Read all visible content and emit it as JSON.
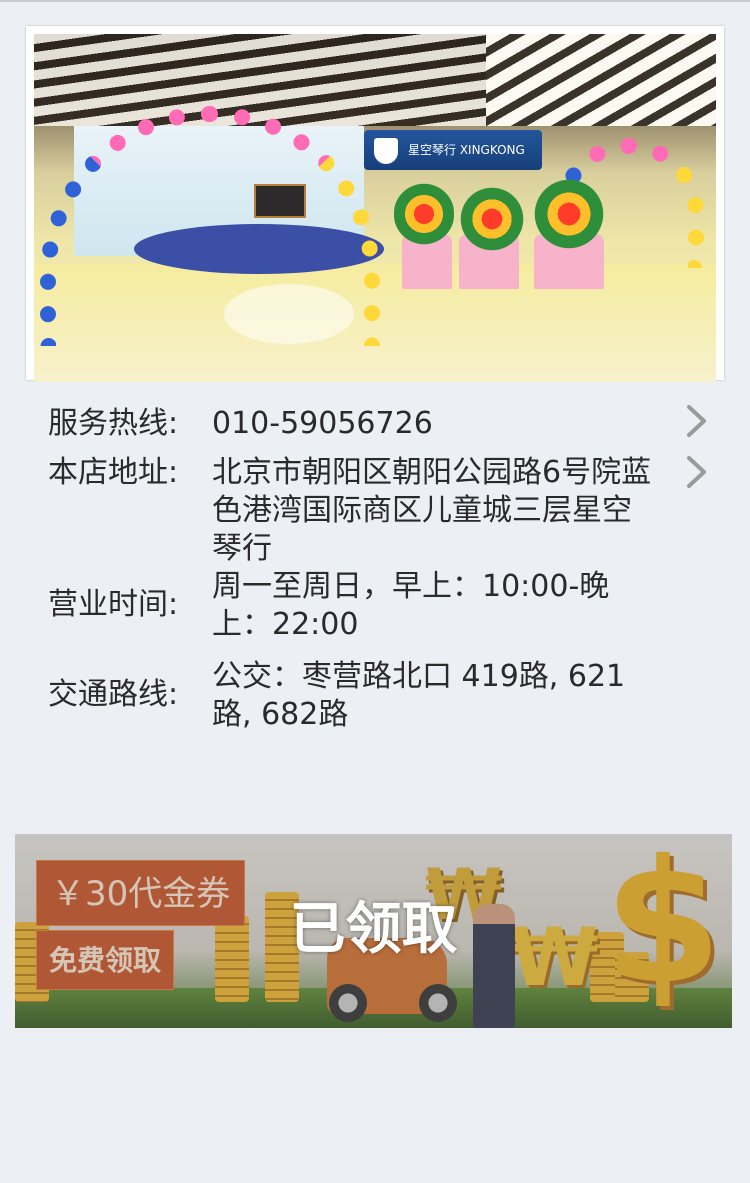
{
  "store": {
    "photo_sign_text": "星空琴行 XINGKONG"
  },
  "info": {
    "hotline": {
      "label": "服务热线:",
      "value": "010-59056726"
    },
    "address": {
      "label": "本店地址:",
      "value": "北京市朝阳区朝阳公园路6号院蓝色港湾国际商区儿童城三层星空琴行"
    },
    "hours": {
      "label": "营业时间:",
      "value": "周一至周日，早上：10:00-晚上：22:00"
    },
    "transit": {
      "label": "交通路线:",
      "value": "公交：枣营路北口 419路, 621路, 682路"
    }
  },
  "coupon": {
    "amount": "￥30代金券",
    "free_label": "免费领取",
    "status": "已领取"
  },
  "icons": {
    "hotline_arrow": "chevron-right-icon",
    "address_arrow": "chevron-right-icon"
  },
  "colors": {
    "background": "#eceff4",
    "coupon_tag": "#c9501f",
    "chevron": "#9a9a9a"
  }
}
